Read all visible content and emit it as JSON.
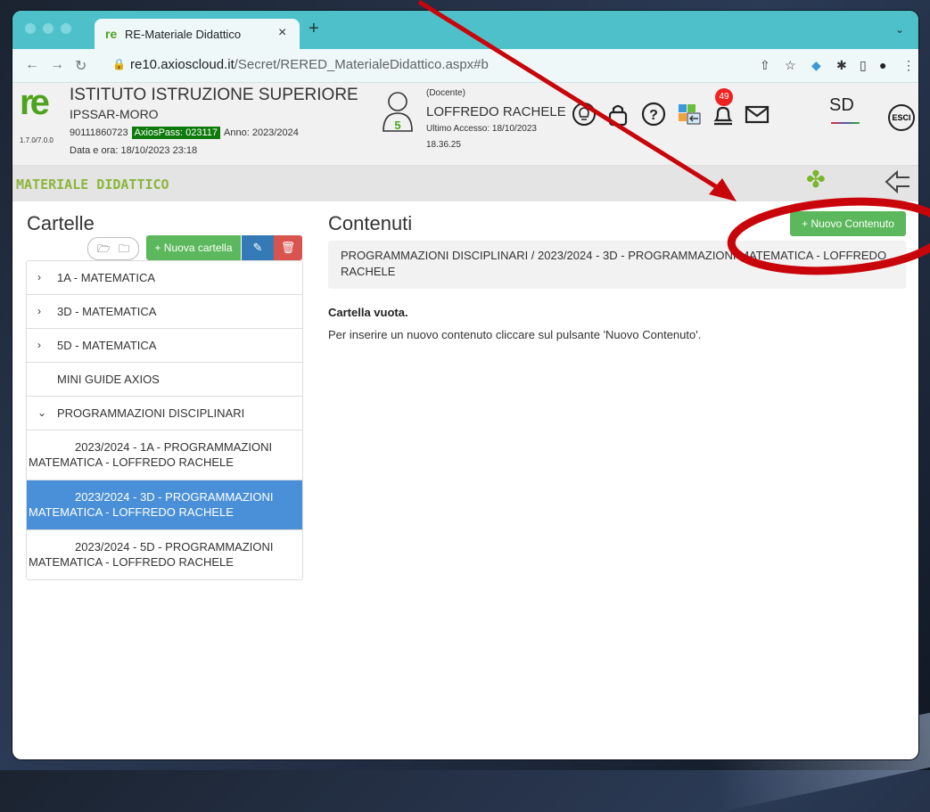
{
  "browser": {
    "tab_title": "RE-Materiale Didattico",
    "tab_close": "×",
    "new_tab": "+",
    "url_host": "re10.axioscloud.it",
    "url_path": "/Secret/RERED_MaterialeDidattico.aspx#b"
  },
  "header": {
    "logo": "re",
    "version": "1.7.0/7.0.0",
    "institute_name": "ISTITUTO ISTRUZIONE SUPERIORE",
    "institute_sub": "IPSSAR-MORO",
    "code": "90111860723",
    "axios_pass": "AxiosPass: 023117",
    "anno": "Anno: 2023/2024",
    "datetime": "Data e ora: 18/10/2023 23:18",
    "avatar_number": "5",
    "role": "(Docente)",
    "user_name": "LOFFREDO RACHELE",
    "last_access": "Ultimo Accesso: 18/10/2023",
    "last_access_time": "18.36.25",
    "notification_count": "49",
    "sd_label": "SD",
    "esci_label": "ESCI"
  },
  "section": {
    "title": "MATERIALE DIDATTICO"
  },
  "sidebar": {
    "title": "Cartelle",
    "new_folder_label": "+ Nuova cartella",
    "edit_icon": "✎",
    "delete_icon": "🗑",
    "items": [
      {
        "label": "1A - MATEMATICA",
        "chevron": "›"
      },
      {
        "label": "3D - MATEMATICA",
        "chevron": "›"
      },
      {
        "label": "5D - MATEMATICA",
        "chevron": "›"
      },
      {
        "label": "MINI GUIDE AXIOS",
        "chevron": ""
      },
      {
        "label": "PROGRAMMAZIONI DISCIPLINARI",
        "chevron": "⌄"
      },
      {
        "label": "2023/2024 - 1A - PROGRAMMAZIONI MATEMATICA - LOFFREDO RACHELE"
      },
      {
        "label": "2023/2024 - 3D - PROGRAMMAZIONI MATEMATICA - LOFFREDO RACHELE"
      },
      {
        "label": "2023/2024 - 5D - PROGRAMMAZIONI MATEMATICA - LOFFREDO RACHELE"
      }
    ]
  },
  "main": {
    "title": "Contenuti",
    "new_content_label": "+ Nuovo Contenuto",
    "breadcrumb": "PROGRAMMAZIONI DISCIPLINARI / 2023/2024 - 3D - PROGRAMMAZIONI MATEMATICA - LOFFREDO RACHELE",
    "empty_title": "Cartella vuota.",
    "empty_text": "Per inserire un nuovo contenuto cliccare sul pulsante 'Nuovo Contenuto'."
  },
  "colors": {
    "tab_bar": "#4ec0c9",
    "brand_green": "#4ea31e",
    "button_green": "#5cb85c",
    "selected_blue": "#4a90d9",
    "annotation_red": "#c8050a"
  }
}
